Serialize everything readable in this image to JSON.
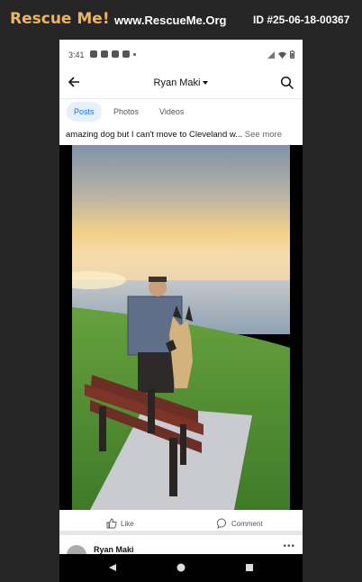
{
  "header": {
    "logo_text": "Rescue Me!",
    "site": "www.RescueMe.Org",
    "pet_id": "ID #25-06-18-00367"
  },
  "status_bar": {
    "time": "3:41"
  },
  "app_bar": {
    "title": "Ryan Maki"
  },
  "tabs": [
    {
      "label": "Posts",
      "active": true
    },
    {
      "label": "Photos",
      "active": false
    },
    {
      "label": "Videos",
      "active": false
    }
  ],
  "post": {
    "caption": "amazing dog but I can't move to Cleveland w...",
    "see_more": "See more"
  },
  "actions": {
    "like": "Like",
    "comment": "Comment"
  },
  "next_post": {
    "author": "Ryan Maki"
  },
  "colors": {
    "logo": "#f0b558",
    "accent": "#1a73e8",
    "page_bg": "#262626"
  }
}
